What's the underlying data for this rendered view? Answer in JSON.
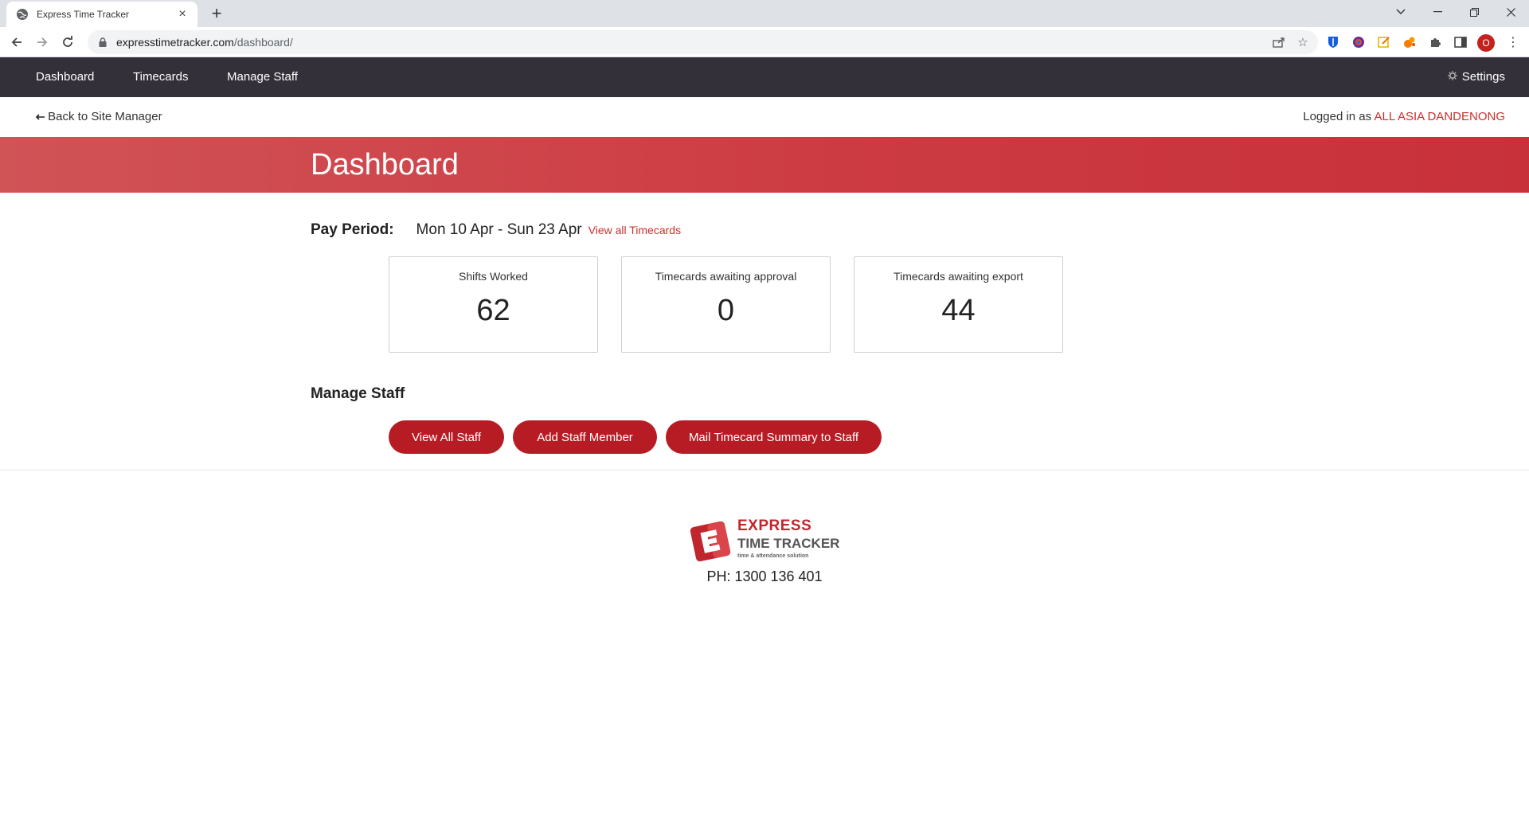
{
  "browser": {
    "tab_title": "Express Time Tracker",
    "new_tab": "+",
    "url_host": "expresstimetracker.com",
    "url_path": "/dashboard/",
    "profile_initial": "O"
  },
  "nav": {
    "dashboard": "Dashboard",
    "timecards": "Timecards",
    "manage_staff": "Manage Staff",
    "settings": "Settings"
  },
  "subbar": {
    "back_link": "Back to Site Manager",
    "logged_in_prefix": "Logged in as",
    "user": "ALL ASIA DANDENONG"
  },
  "page": {
    "title": "Dashboard"
  },
  "pay_period": {
    "label": "Pay Period:",
    "range": "Mon 10 Apr - Sun 23 Apr",
    "link": "View all Timecards"
  },
  "stats": [
    {
      "label": "Shifts Worked",
      "value": "62"
    },
    {
      "label": "Timecards awaiting approval",
      "value": "0"
    },
    {
      "label": "Timecards awaiting export",
      "value": "44"
    }
  ],
  "manage_staff": {
    "title": "Manage Staff",
    "buttons": [
      "View All Staff",
      "Add Staff Member",
      "Mail Timecard Summary to Staff"
    ]
  },
  "footer": {
    "logo_line1": "EXPRESS",
    "logo_line2": "TIME TRACKER",
    "logo_line3": "time & attendance solution",
    "phone": "PH: 1300 136 401"
  },
  "colors": {
    "accent": "#c9302c",
    "nav_bg": "#33303a",
    "button_bg": "#b71c24"
  }
}
